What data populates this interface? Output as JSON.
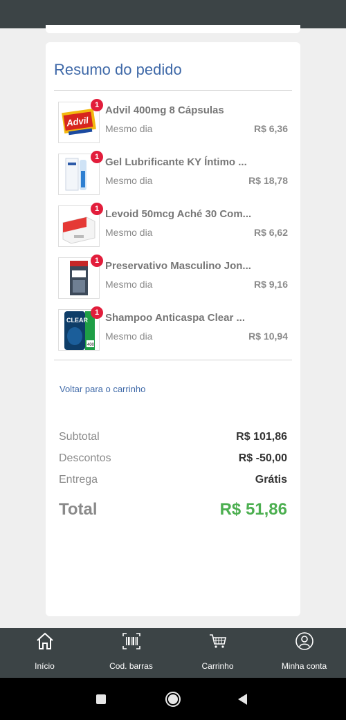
{
  "order_summary": {
    "title": "Resumo do pedido",
    "items": [
      {
        "name": "Advil 400mg 8 Cápsulas",
        "quantity": "1",
        "delivery": "Mesmo dia",
        "price": "R$ 6,36"
      },
      {
        "name": "Gel Lubrificante KY Íntimo ...",
        "quantity": "1",
        "delivery": "Mesmo dia",
        "price": "R$ 18,78"
      },
      {
        "name": "Levoid 50mcg Aché 30 Com...",
        "quantity": "1",
        "delivery": "Mesmo dia",
        "price": "R$ 6,62"
      },
      {
        "name": "Preservativo Masculino Jon...",
        "quantity": "1",
        "delivery": "Mesmo dia",
        "price": "R$ 9,16"
      },
      {
        "name": "Shampoo Anticaspa Clear ...",
        "quantity": "1",
        "delivery": "Mesmo dia",
        "price": "R$ 10,94"
      }
    ],
    "back_link": "Voltar para o carrinho",
    "subtotal_label": "Subtotal",
    "subtotal_value": "R$ 101,86",
    "discount_label": "Descontos",
    "discount_value": "R$ -50,00",
    "delivery_label": "Entrega",
    "delivery_value": "Grátis",
    "total_label": "Total",
    "total_value": "R$ 51,86"
  },
  "product_art": {
    "advil_logo": "Advil",
    "clear_logo": "CLEAR",
    "clear_size": "400"
  },
  "bottom_nav": {
    "items": [
      {
        "label": "Início",
        "icon": "home-icon"
      },
      {
        "label": "Cod. barras",
        "icon": "barcode-icon"
      },
      {
        "label": "Carrinho",
        "icon": "cart-icon"
      },
      {
        "label": "Minha conta",
        "icon": "account-icon"
      }
    ]
  },
  "colors": {
    "accent": "#3f69a8",
    "badge": "#e21d3b",
    "total": "#4caf50",
    "nav_bg": "#3c4446"
  }
}
